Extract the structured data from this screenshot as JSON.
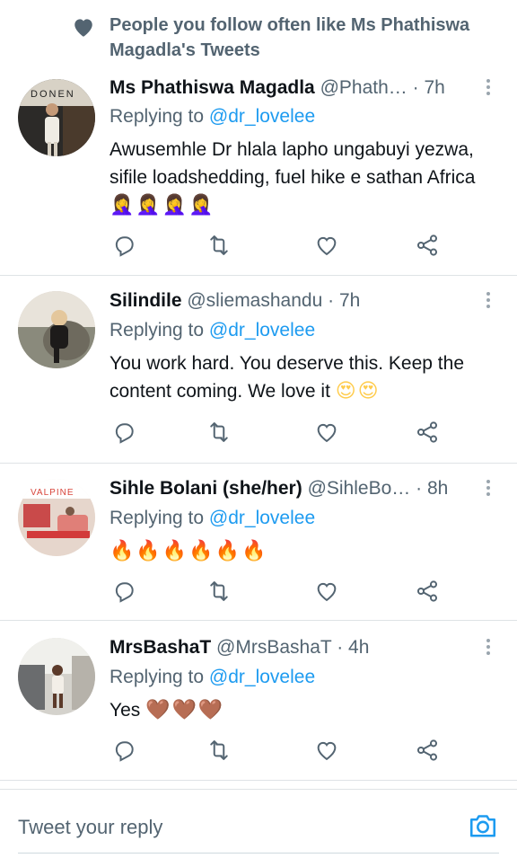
{
  "social_context": {
    "text": "People you follow often like Ms Phathiswa Magadla's Tweets",
    "icon": "heart-icon"
  },
  "tweets": [
    {
      "name": "Ms Phathiswa Magadla",
      "handle": "@Phath…",
      "time": "7h",
      "replying_prefix": "Replying to ",
      "replying_to": "@dr_lovelee",
      "text": "Awusemhle Dr hlala lapho ungabuyi yezwa, sifile loadshedding, fuel hike e sathan Africa",
      "emoji": "🤦‍♀️🤦‍♀️🤦‍♀️🤦‍♀️"
    },
    {
      "name": "Silindile",
      "handle": "@sliemashandu",
      "time": "7h",
      "replying_prefix": "Replying to ",
      "replying_to": "@dr_lovelee",
      "text": "You work hard. You deserve this. Keep the content coming. We love it",
      "emoji": "😍😍"
    },
    {
      "name": "Sihle Bolani (she/her)",
      "handle": "@SihleBo…",
      "time": "8h",
      "replying_prefix": "Replying to ",
      "replying_to": "@dr_lovelee",
      "text": "",
      "emoji": "🔥🔥🔥🔥🔥🔥"
    },
    {
      "name": "MrsBashaT",
      "handle": "@MrsBashaT",
      "time": "4h",
      "replying_prefix": "Replying to ",
      "replying_to": "@dr_lovelee",
      "text": "Yes",
      "emoji": "🤎🤎🤎"
    }
  ],
  "actions": [
    "reply-icon",
    "retweet-icon",
    "like-icon",
    "share-icon"
  ],
  "reply_bar": {
    "placeholder": "Tweet your reply",
    "icon": "camera-icon"
  },
  "colors": {
    "accent": "#1d9bf0",
    "secondary_text": "#536471",
    "divider": "#dfe3e6"
  }
}
